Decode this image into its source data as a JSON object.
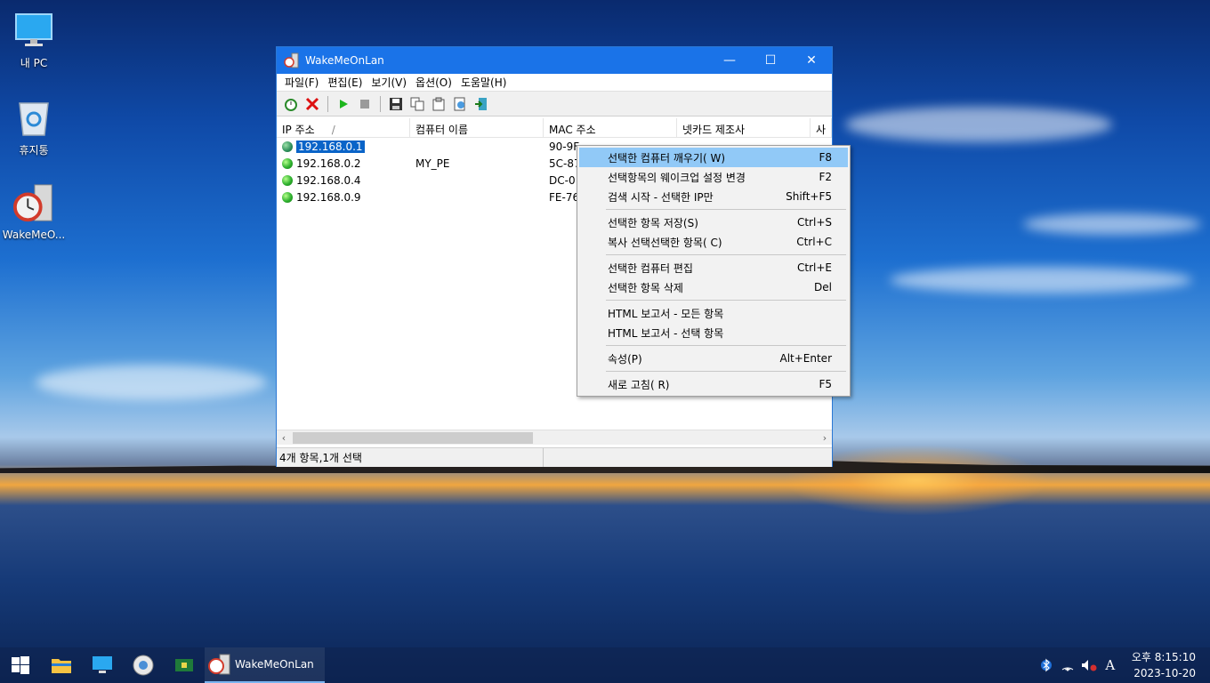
{
  "desktop": {
    "icons": [
      {
        "label": "내 PC",
        "icon": "monitor-icon"
      },
      {
        "label": "휴지통",
        "icon": "recycle-bin-icon"
      },
      {
        "label": "WakeMeO...",
        "icon": "wakemeonlan-icon"
      }
    ]
  },
  "window": {
    "title": "WakeMeOnLan",
    "controls": {
      "minimize": "—",
      "maximize": "☐",
      "close": "✕"
    },
    "menu": [
      "파일(F)",
      "편집(E)",
      "보기(V)",
      "옵션(O)",
      "도움말(H)"
    ],
    "toolbar": [
      "alarm-clock-icon",
      "delete-x-icon",
      "play-icon",
      "stop-icon",
      "save-icon",
      "copy-icon",
      "properties-icon",
      "html-report-icon",
      "exit-icon"
    ],
    "columns": [
      "IP 주소",
      "컴퓨터 이름",
      "MAC 주소",
      "넷카드 제조사",
      "사"
    ],
    "sort_indicator": "/",
    "rows": [
      {
        "ip": "192.168.0.1",
        "name": "",
        "mac": "90-9F-...",
        "selected": true
      },
      {
        "ip": "192.168.0.2",
        "name": "MY_PE",
        "mac": "5C-87",
        "selected": false
      },
      {
        "ip": "192.168.0.4",
        "name": "",
        "mac": "DC-0",
        "selected": false
      },
      {
        "ip": "192.168.0.9",
        "name": "",
        "mac": "FE-76",
        "selected": false
      }
    ],
    "status": "4개 항목,1개 선택",
    "colors": {
      "titlebar": "#1a73e8",
      "selection": "#0a64c8",
      "menu_highlight": "#91c9f7"
    }
  },
  "context_menu": {
    "groups": [
      [
        {
          "label": "선택한 컴퓨터 깨우기(  W)",
          "shortcut": "F8",
          "highlighted": true
        },
        {
          "label": "선택항목의 웨이크업 설정 변경",
          "shortcut": "F2"
        },
        {
          "label": "검색 시작 - 선택한 IP만",
          "shortcut": "Shift+F5"
        }
      ],
      [
        {
          "label": "선택한 항목 저장(S)",
          "shortcut": "Ctrl+S"
        },
        {
          "label": "복사 선택선택한 항목(  C)",
          "shortcut": "Ctrl+C"
        }
      ],
      [
        {
          "label": "선택한 컴퓨터 편집",
          "shortcut": "Ctrl+E"
        },
        {
          "label": "선택한 항목 삭제",
          "shortcut": "Del"
        }
      ],
      [
        {
          "label": "HTML 보고서 - 모든 항목",
          "shortcut": ""
        },
        {
          "label": "HTML 보고서 - 선택 항목",
          "shortcut": ""
        }
      ],
      [
        {
          "label": "속성(P)",
          "shortcut": "Alt+Enter"
        }
      ],
      [
        {
          "label": "새로 고침(  R)",
          "shortcut": "F5"
        }
      ]
    ]
  },
  "taskbar": {
    "pinned": [
      "start-icon",
      "file-explorer-icon",
      "monitor-app-icon",
      "system-tool-icon",
      "chip-icon"
    ],
    "running_app": "WakeMeOnLan",
    "clock": {
      "time": "오후 8:15:10",
      "date": "2023-10-20"
    },
    "tray": [
      "bluetooth-icon",
      "network-icon",
      "volume-muted-icon",
      "ime-icon"
    ],
    "ime_label": "A"
  }
}
